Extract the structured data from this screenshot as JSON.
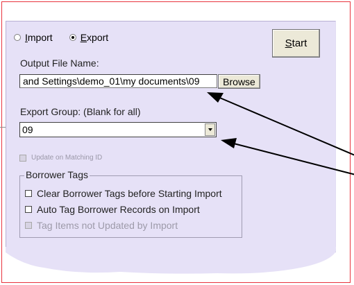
{
  "mode": {
    "import_label": "Import",
    "export_label": "Export",
    "selected": "Export"
  },
  "start_button": {
    "label": "Start"
  },
  "output_file": {
    "label": "Output File Name:",
    "value": "and Settings\\demo_01\\my documents\\09",
    "browse_label": "Browse"
  },
  "export_group": {
    "label": "Export Group: (Blank for all)",
    "selected_value": "09"
  },
  "update_matching": {
    "label": "Update on Matching ID",
    "enabled": false
  },
  "borrower_tags": {
    "title": "Borrower Tags",
    "options": [
      {
        "label": "Clear Borrower Tags before Starting Import",
        "checked": false,
        "enabled": true
      },
      {
        "label": "Auto Tag Borrower Records on Import",
        "checked": false,
        "enabled": true
      },
      {
        "label": "Tag Items not Updated by Import",
        "checked": false,
        "enabled": false
      }
    ]
  },
  "colors": {
    "panel_background": "#e6e1f7",
    "frame_border": "#e8323c",
    "button_face": "#ece9d8"
  }
}
